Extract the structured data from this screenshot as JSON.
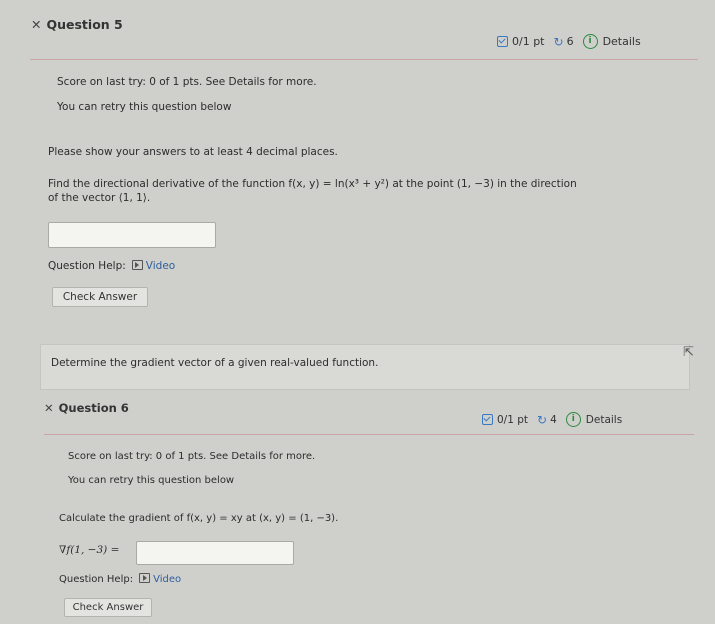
{
  "q5": {
    "title": "Question 5",
    "score_pts": "0/1 pt",
    "retries": "6",
    "details": "Details",
    "score_last_try": "Score on last try: 0 of 1 pts. See Details for more.",
    "retry_note": "You can retry this question below",
    "instruction": "Please show your answers to at least 4 decimal places.",
    "prompt_line1": "Find the directional derivative of the function f(x, y) = ln(x³ + y²) at the point (1, −3) in the direction",
    "prompt_line2": "of the vector ⟨1, 1⟩.",
    "answer_value": "",
    "help_label": "Question Help:",
    "video_label": "Video",
    "check_label": "Check Answer"
  },
  "objective": {
    "text": "Determine the gradient vector of a given real-valued function."
  },
  "q6": {
    "title": "Question 6",
    "score_pts": "0/1 pt",
    "retries": "4",
    "details": "Details",
    "score_last_try": "Score on last try: 0 of 1 pts. See Details for more.",
    "retry_note": "You can retry this question below",
    "prompt": "Calculate the gradient of f(x, y) = xy at (x, y) = (1, −3).",
    "gradient_label": "∇f(1, −3) =",
    "answer_value": "",
    "help_label": "Question Help:",
    "video_label": "Video",
    "check_label": "Check Answer"
  },
  "colors": {
    "page_bg": "#cfcfcc",
    "accent_blue": "#3a78c2",
    "info_green": "#2c8a3f",
    "separator": "#c9a4a4"
  },
  "icons": [
    "close-x-icon",
    "checkbox-icon",
    "retry-icon",
    "info-icon",
    "video-icon",
    "cursor-icon"
  ]
}
